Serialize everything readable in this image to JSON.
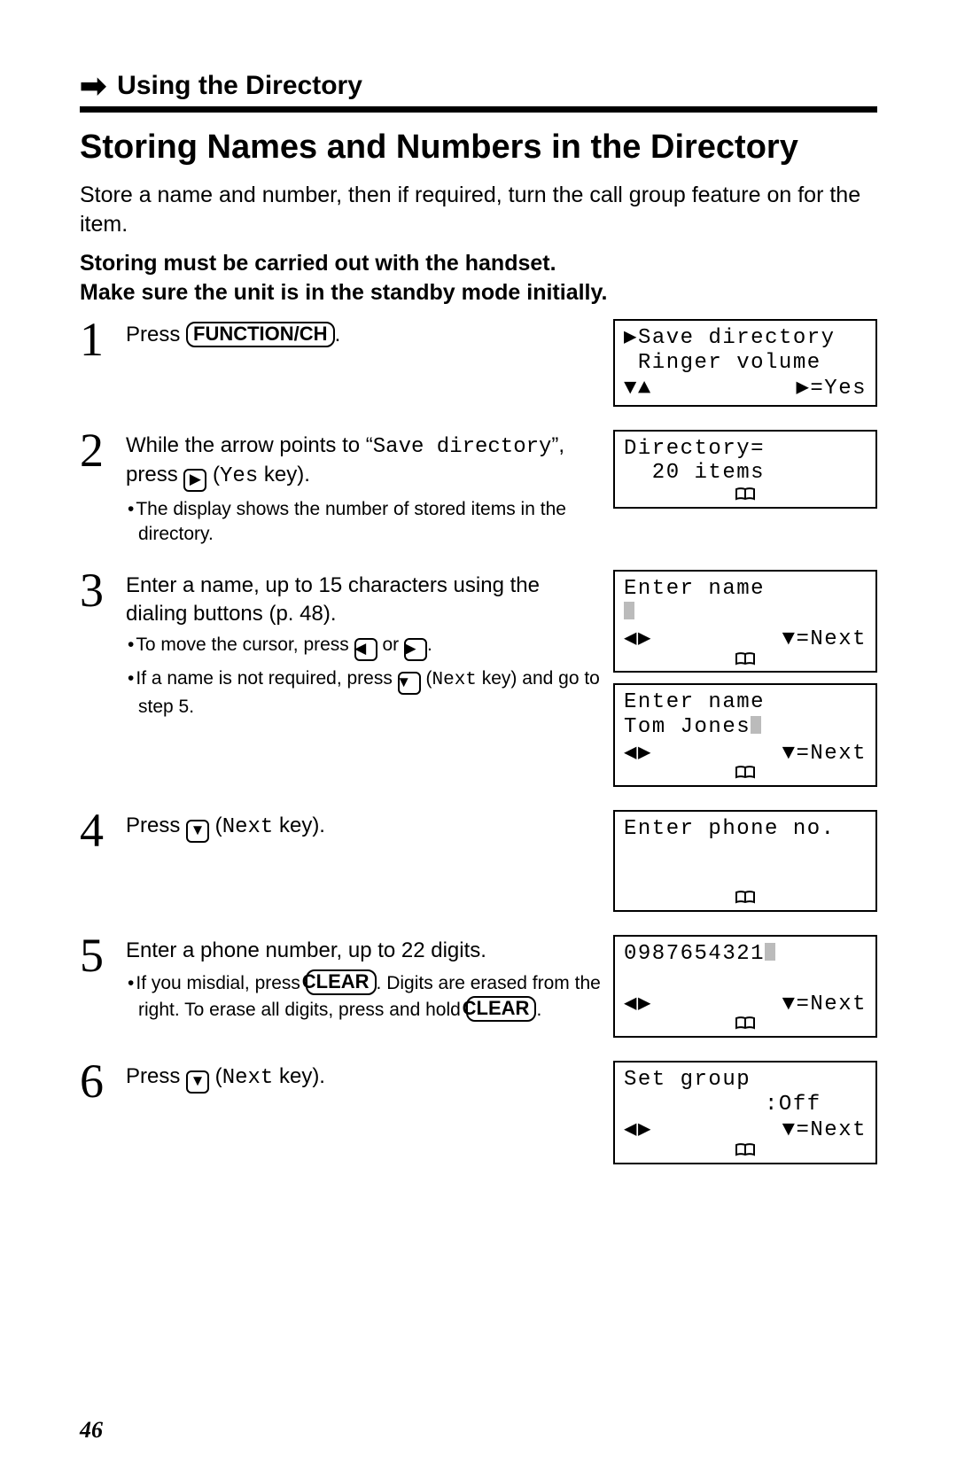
{
  "section_header": "Using the Directory",
  "title": "Storing Names and Numbers in the Directory",
  "intro_lines": [
    "Store a name and number, then if required, turn the call group feature on for the item."
  ],
  "intro_bold_lines": [
    "Storing must be carried out with the handset.",
    "Make sure the unit is in the standby mode initially."
  ],
  "page_number": "46",
  "keys": {
    "function_ch": "FUNCTION/CH",
    "clear": "CLEAR"
  },
  "arrows": {
    "right": "▶",
    "left": "◀",
    "down": "▼",
    "up": "▲",
    "leftright": "◀▶",
    "downup": "▼▲"
  },
  "steps": {
    "s1": {
      "num": "1",
      "pre": "Press ",
      "post": "."
    },
    "s2": {
      "num": "2",
      "a": "While the arrow points to “",
      "save_dir": "Save directory",
      "b": "”, press ",
      "yes": "Yes",
      "c": " key).",
      "sub1": "The display shows the number of stored items in the directory."
    },
    "s3": {
      "num": "3",
      "main": "Enter a name, up to 15 characters using the dialing buttons (p. 48).",
      "sub1a": "To move the cursor, press ",
      "sub1b": " or ",
      "sub1c": ".",
      "sub2a": "If a name is not required, press ",
      "next": "Next",
      "sub2b": " key) and go to step 5."
    },
    "s4": {
      "num": "4",
      "a": "Press ",
      "next": "Next",
      "b": " key)."
    },
    "s5": {
      "num": "5",
      "main": "Enter a phone number, up to 22 digits.",
      "sub_a": "If you misdial, press ",
      "sub_b": ". Digits are erased from the right. To erase all digits, press and hold ",
      "sub_c": "."
    },
    "s6": {
      "num": "6",
      "a": "Press ",
      "next": "Next",
      "b": " key)."
    }
  },
  "screens": {
    "sc1": {
      "l1": "▶Save directory",
      "l2": " Ringer volume",
      "blft": "▼▲",
      "brgt": "▶=Yes"
    },
    "sc2": {
      "l1": "Directory=",
      "l2": "  20 items"
    },
    "sc3": {
      "l1": "Enter name",
      "blft": "◀▶",
      "brgt": "▼=Next"
    },
    "sc3b": {
      "l1": "Enter name",
      "l2": "Tom Jones",
      "blft": "◀▶",
      "brgt": "▼=Next"
    },
    "sc4": {
      "l1": "Enter phone no."
    },
    "sc5": {
      "l1": "0987654321",
      "blft": "◀▶",
      "brgt": "▼=Next"
    },
    "sc6": {
      "l1": "Set group",
      "l2": "          :Off",
      "blft": "◀▶",
      "brgt": "▼=Next"
    }
  }
}
